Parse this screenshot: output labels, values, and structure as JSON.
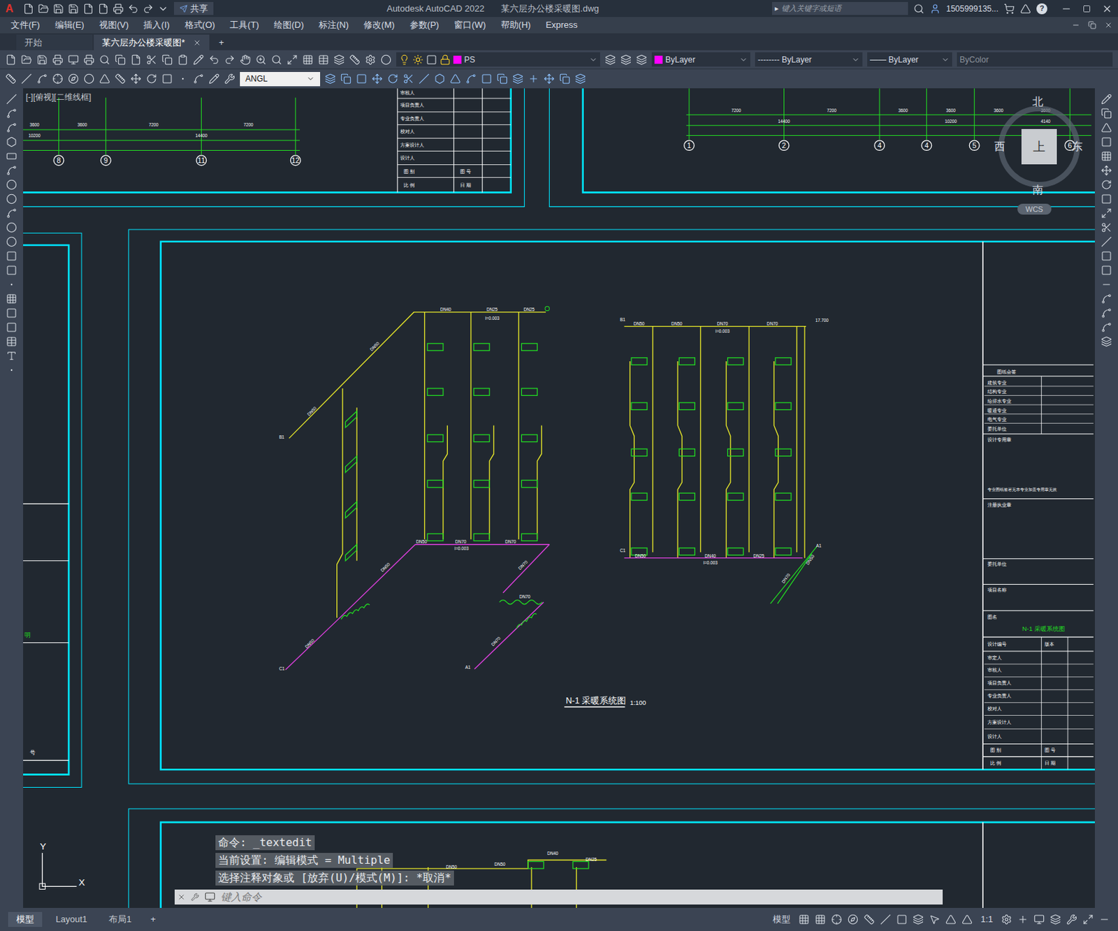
{
  "window": {
    "app_letter": "A",
    "share": "共享",
    "title": "Autodesk AutoCAD 2022",
    "file": "某六层办公楼采暖图.dwg",
    "search_arrow": "▸",
    "search_placeholder": "键入关键字或短语",
    "user": "1505999135...",
    "help": "?"
  },
  "menu": [
    "文件(F)",
    "编辑(E)",
    "视图(V)",
    "插入(I)",
    "格式(O)",
    "工具(T)",
    "绘图(D)",
    "标注(N)",
    "修改(M)",
    "参数(P)",
    "窗口(W)",
    "帮助(H)",
    "Express"
  ],
  "doc_tabs": [
    {
      "label": "开始",
      "selected": false
    },
    {
      "label": "某六层办公楼采暖图*",
      "selected": true
    }
  ],
  "new_tab": "+",
  "properties": {
    "layer": "PS",
    "layer_color": "#ff00ff",
    "color": "ByLayer",
    "color_swatch": "#ff00ff",
    "linetype": "-------- ByLayer",
    "lineweight": "—— ByLayer",
    "plotstyle": "ByColor"
  },
  "dim_style": "ANGL",
  "viewport_label": "[-][俯视][二维线框]",
  "viewcube": {
    "north": "北",
    "south": "南",
    "west": "西",
    "east": "东",
    "top": "上",
    "wcs": "WCS"
  },
  "ucs": {
    "x": "X",
    "y": "Y"
  },
  "drawing": {
    "top_left": {
      "dims": [
        "3600",
        "3600",
        "7200",
        "7200",
        "10200",
        "14400"
      ],
      "axes": [
        "8",
        "9",
        "11",
        "12"
      ],
      "people": [
        "审核人",
        "项目负责人",
        "专业负责人",
        "校对人",
        "方案设计人",
        "设计人"
      ],
      "footer": [
        "图 别",
        "图 号",
        "比 例",
        "日 期"
      ]
    },
    "top_right": {
      "dims": [
        "7200",
        "7200",
        "3600",
        "3600",
        "3600",
        "3600",
        "14400",
        "10200",
        "4140"
      ],
      "axes": [
        "1",
        "2",
        "4",
        "4",
        "5",
        "6"
      ]
    },
    "left_partial": {
      "labels": [
        "明",
        "号"
      ]
    },
    "system_left": {
      "labels": [
        "B1",
        "DN50",
        "DN50",
        "DN40",
        "DN25",
        "DN25",
        "i=0.003",
        "DN50",
        "DN70",
        "i=0.003",
        "DN70",
        "DN50",
        "DN50",
        "DN70",
        "DN70",
        "DN70",
        "C1",
        "A1"
      ]
    },
    "system_right": {
      "labels": [
        "B1",
        "DN50",
        "DN50",
        "DN70",
        "i=0.003",
        "DN70",
        "17.700",
        "DN50",
        "DN40",
        "i=0.003",
        "DN25",
        "C1",
        "A1",
        "DN50",
        "DN70"
      ]
    },
    "title": "N-1 采暖系统图",
    "scale": "1:100",
    "title_block": {
      "countersign_title": "图纸会签",
      "countersign": [
        "建筑专业",
        "结构专业",
        "给排水专业",
        "暖通专业",
        "电气专业",
        "委托单位"
      ],
      "seal": "设计专用章",
      "seal_note": "专业图纸签署无本专业加盖专用章无效",
      "reg_seal": "注册执业章",
      "client": "委托单位",
      "project": "项目名称",
      "drawing_name": "图名",
      "drawing_name_value": "N-1 采暖系统图",
      "number": "设计编号",
      "version": "版本",
      "people": [
        "审定人",
        "审核人",
        "项目负责人",
        "专业负责人",
        "校对人",
        "方案设计人",
        "设计人"
      ],
      "footer": [
        "图 别",
        "图 号",
        "比 例",
        "日 期"
      ]
    },
    "bottom_partial": {
      "labels": [
        "DN40",
        "DN25",
        "DN50",
        "DN50"
      ]
    }
  },
  "command": {
    "history": [
      "命令: _textedit",
      "当前设置: 编辑模式 = Multiple",
      "选择注释对象或 [放弃(U)/模式(M)]: *取消*"
    ],
    "placeholder": "键入命令"
  },
  "layout_tabs": [
    {
      "label": "模型",
      "selected": true
    },
    {
      "label": "Layout1",
      "selected": false
    },
    {
      "label": "布局1",
      "selected": false
    }
  ],
  "layout_add": "+",
  "status_bar": {
    "mode": "模型",
    "scale": "1:1"
  }
}
